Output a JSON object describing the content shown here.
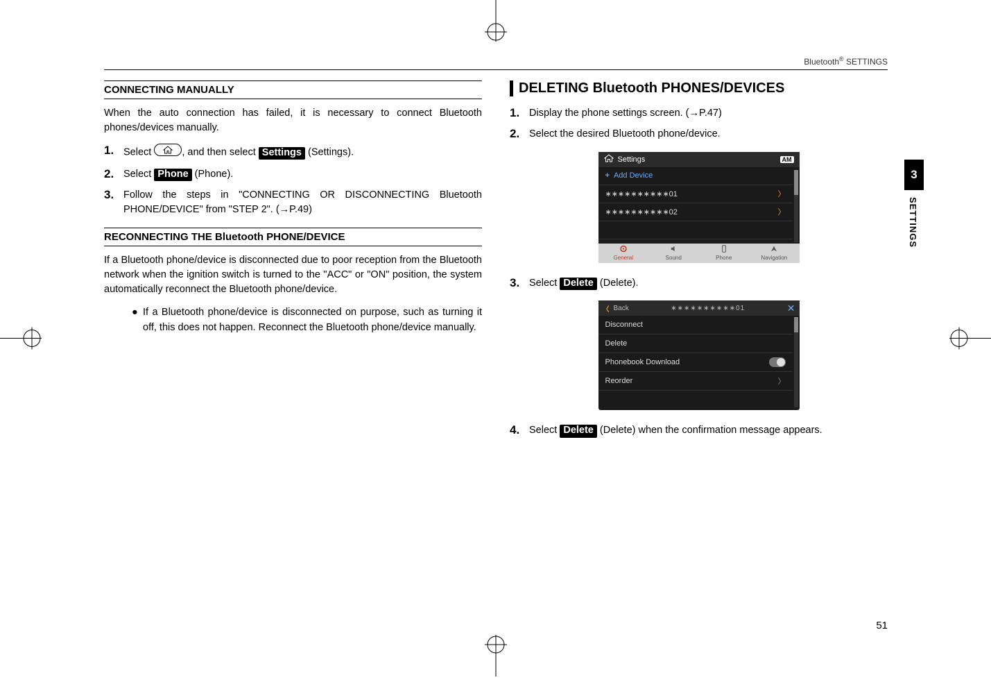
{
  "header": {
    "label_pre": "Bluetooth",
    "label_sup": "®",
    "label_post": " SETTINGS"
  },
  "sideTab": {
    "number": "3",
    "text": "SETTINGS"
  },
  "pageNumber": "51",
  "left": {
    "section1": {
      "title": "CONNECTING MANUALLY",
      "intro": "When the auto connection has failed, it is necessary to connect Bluetooth phones/devices manually.",
      "steps": {
        "s1": {
          "num": "1.",
          "pre": "Select ",
          "mid": ", and then select ",
          "tag": "Settings",
          "post": " (Settings)."
        },
        "s2": {
          "num": "2.",
          "pre": "Select ",
          "tag": "Phone",
          "post": " (Phone)."
        },
        "s3": {
          "num": "3.",
          "text": "Follow the steps in \"CONNECTING OR DISCONNECTING Bluetooth PHONE/DEVICE\" from \"STEP 2\". (→P.49)"
        }
      }
    },
    "section2": {
      "title": "RECONNECTING THE Bluetooth PHONE/DEVICE",
      "intro": "If a Bluetooth phone/device is disconnected due to poor reception from the Bluetooth network when the ignition switch is turned to the \"ACC\" or \"ON\" position, the system automatically reconnect the Bluetooth phone/device.",
      "bullet": "If a Bluetooth phone/device is disconnected on purpose, such as turning it off, this does not happen. Reconnect the Bluetooth phone/device manually."
    }
  },
  "right": {
    "h2": "DELETING Bluetooth PHONES/DEVICES",
    "steps": {
      "s1": {
        "num": "1.",
        "text": "Display the phone settings screen. (→P.47)"
      },
      "s2": {
        "num": "2.",
        "text": "Select the desired Bluetooth phone/device."
      },
      "s3": {
        "num": "3.",
        "pre": "Select ",
        "tag": "Delete",
        "post": " (Delete)."
      },
      "s4": {
        "num": "4.",
        "pre": "Select ",
        "tag": "Delete",
        "post": " (Delete) when the confirmation message appears."
      }
    },
    "screenshot1": {
      "title": "Settings",
      "am": "AM",
      "rows": {
        "r0": "Add Device",
        "r1": "∗∗∗∗∗∗∗∗∗∗01",
        "r2": "∗∗∗∗∗∗∗∗∗∗02"
      },
      "tabs": {
        "t0": "General",
        "t1": "Sound",
        "t2": "Phone",
        "t3": "Navigation"
      }
    },
    "screenshot2": {
      "back": "Back",
      "title": "∗∗∗∗∗∗∗∗∗∗01",
      "rows": {
        "r0": "Disconnect",
        "r1": "Delete",
        "r2": "Phonebook Download",
        "r3": "Reorder"
      }
    }
  }
}
